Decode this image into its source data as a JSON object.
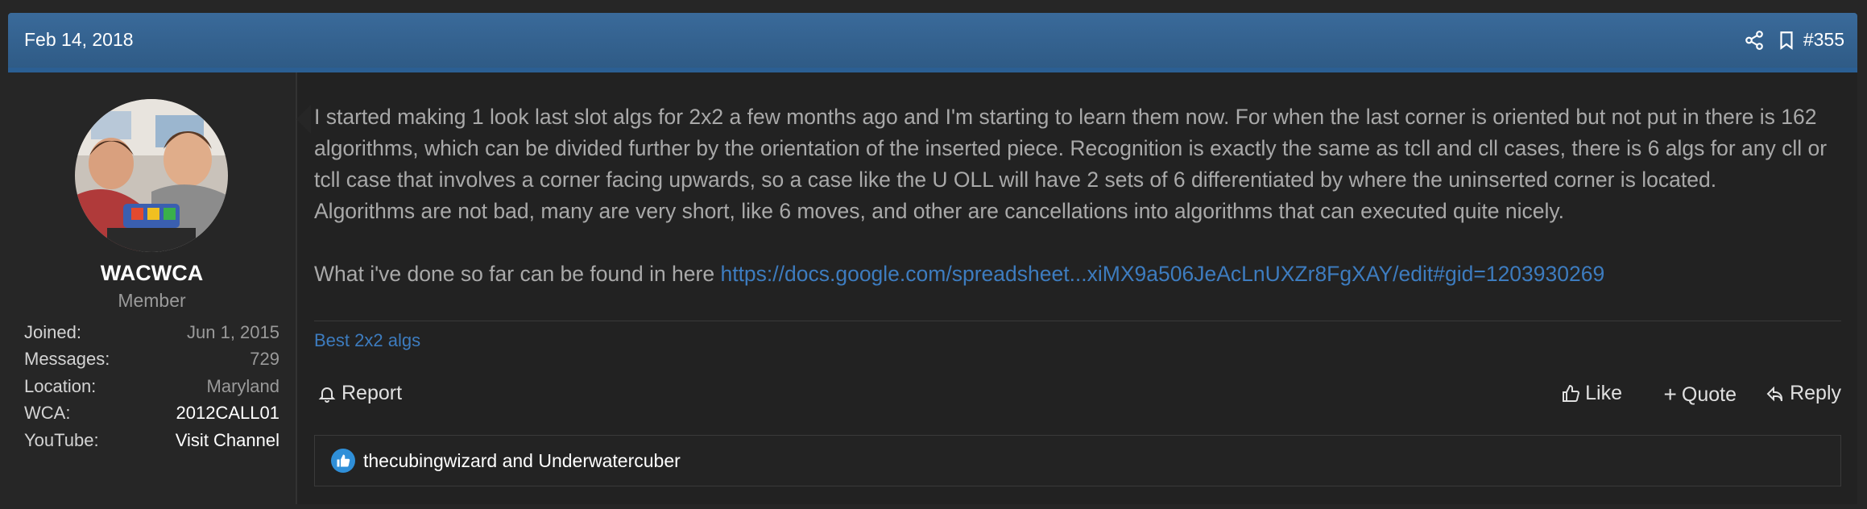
{
  "post": {
    "date": "Feb 14, 2018",
    "number": "#355",
    "icons": {
      "share": "share-icon",
      "bookmark": "bookmark-icon"
    }
  },
  "user": {
    "name": "WACWCA",
    "title": "Member",
    "stats": [
      {
        "label": "Joined:",
        "value": "Jun 1, 2015"
      },
      {
        "label": "Messages:",
        "value": "729"
      },
      {
        "label": "Location:",
        "value": "Maryland"
      },
      {
        "label": "WCA:",
        "value": "2012CALL01"
      },
      {
        "label": "YouTube:",
        "value": "Visit Channel"
      }
    ]
  },
  "message": {
    "paragraph1": "I started making 1 look last slot algs for 2x2 a few months ago and I'm starting to learn them now. For when the last corner is oriented but not put in there is 162 algorithms, which can be divided further by the orientation of the inserted piece. Recognition is exactly the same as tcll and cll cases, there is 6 algs for any cll or tcll case that involves a corner facing upwards, so a case like the U OLL will have 2 sets of 6 differentiated by where the uninserted corner is located.",
    "paragraph2": "Algorithms are not bad, many are very short, like 6 moves, and other are cancellations into algorithms that can executed quite nicely.",
    "paragraph3_prefix": "What i've done so far can be found in here ",
    "link": "https://docs.google.com/spreadsheet...xiMX9a506JeAcLnUXZr8FgXAY/edit#gid=1203930269"
  },
  "signature": "Best 2x2 algs",
  "actions": {
    "report": "Report",
    "like": "Like",
    "quote": "Quote",
    "reply": "Reply"
  },
  "reactions": {
    "text": "thecubingwizard and Underwatercuber"
  },
  "colors": {
    "header": "#2f5b86",
    "link": "#3d7cbf",
    "like_badge": "#2f8fd8"
  }
}
